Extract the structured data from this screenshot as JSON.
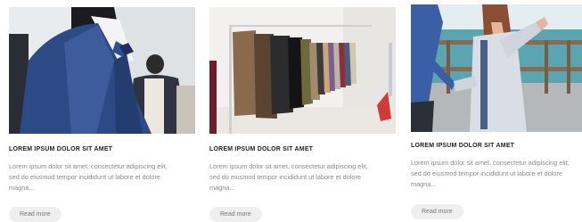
{
  "cards": [
    {
      "image_icon": "suit-mannequin-photo",
      "title": "LOREM IPSUM DOLOR SIT AMET",
      "excerpt_lines": [
        "Lorem ipsum dolor sit amet, consectetur adipiscing elit,",
        "sed do eiusmod tempor incididunt ut labore et dolore",
        "magna..."
      ],
      "button": "Read more"
    },
    {
      "image_icon": "clothing-rack-photo",
      "title": "LOREM IPSUM DOLOR SIT AMET",
      "excerpt_lines": [
        "Lorem ipsum dolor sit amet, consectetur adipiscing elit,",
        "sed do eiusmod tempor incididunt ut labore et dolore",
        "magna..."
      ],
      "button": "Read more"
    },
    {
      "image_icon": "couple-seaside-photo",
      "title": "LOREM IPSUM DOLOR SIT AMET",
      "excerpt_lines": [
        "Lorem ipsum dolor sit amet, consectetur adipiscing elit,",
        "sed do eiusmod tempor incididunt ut labore et dolore",
        "magna..."
      ],
      "button": "Read more"
    }
  ]
}
